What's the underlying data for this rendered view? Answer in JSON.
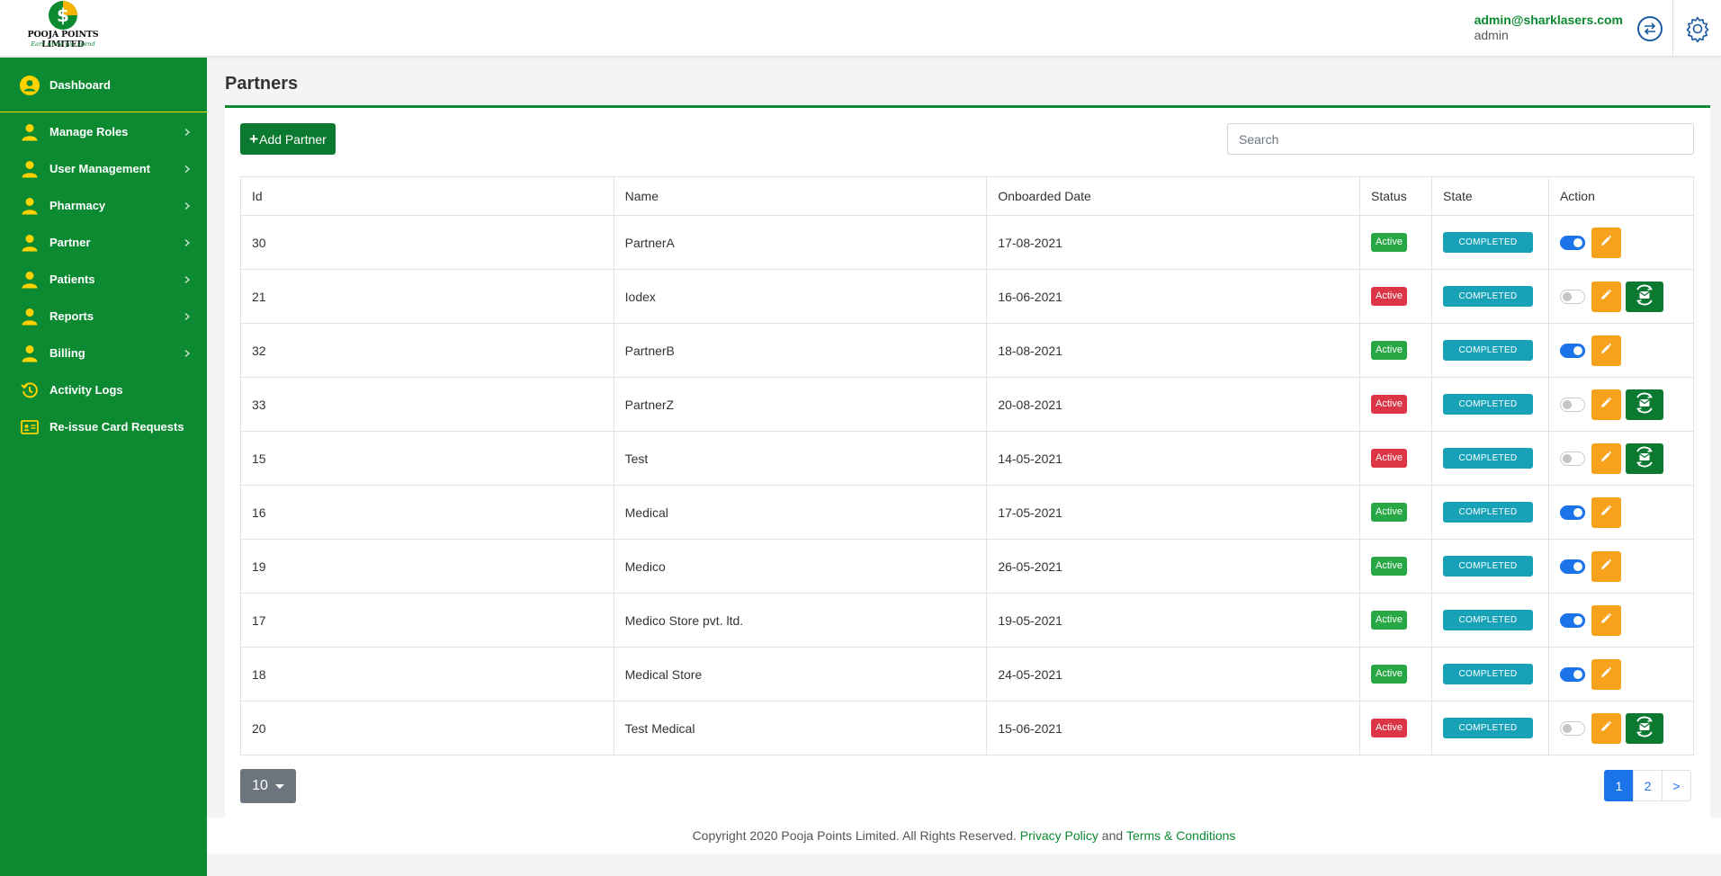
{
  "header": {
    "brand_title": "POOJA POINTS LIMITED",
    "brand_tagline": "Earn while you spend",
    "user_email": "admin@sharklasers.com",
    "user_role": "admin",
    "icons": {
      "swap": "swap-icon",
      "settings": "gear-icon"
    }
  },
  "sidebar": {
    "items": [
      {
        "label": "Dashboard",
        "icon": "user-circle-icon",
        "chevron": false
      },
      {
        "label": "Manage Roles",
        "icon": "user-icon",
        "chevron": true
      },
      {
        "label": "User Management",
        "icon": "user-icon",
        "chevron": true
      },
      {
        "label": "Pharmacy",
        "icon": "user-icon",
        "chevron": true
      },
      {
        "label": "Partner",
        "icon": "user-icon",
        "chevron": true
      },
      {
        "label": "Patients",
        "icon": "user-icon",
        "chevron": true
      },
      {
        "label": "Reports",
        "icon": "user-icon",
        "chevron": true
      },
      {
        "label": "Billing",
        "icon": "user-icon",
        "chevron": true
      },
      {
        "label": "Activity Logs",
        "icon": "history-icon",
        "chevron": false
      },
      {
        "label": "Re-issue Card Requests",
        "icon": "id-card-icon",
        "chevron": false
      }
    ]
  },
  "main": {
    "title": "Partners",
    "add_button_label": "Add Partner",
    "search_placeholder": "Search",
    "columns": [
      "Id",
      "Name",
      "Onboarded Date",
      "Status",
      "State",
      "Action"
    ],
    "rows": [
      {
        "id": "30",
        "name": "PartnerA",
        "date": "17-08-2021",
        "status": "Active",
        "status_ok": true,
        "state": "COMPLETED",
        "enabled": true,
        "resend": false
      },
      {
        "id": "21",
        "name": "Iodex",
        "date": "16-06-2021",
        "status": "Active",
        "status_ok": false,
        "state": "COMPLETED",
        "enabled": false,
        "resend": true
      },
      {
        "id": "32",
        "name": "PartnerB",
        "date": "18-08-2021",
        "status": "Active",
        "status_ok": true,
        "state": "COMPLETED",
        "enabled": true,
        "resend": false
      },
      {
        "id": "33",
        "name": "PartnerZ",
        "date": "20-08-2021",
        "status": "Active",
        "status_ok": false,
        "state": "COMPLETED",
        "enabled": false,
        "resend": true
      },
      {
        "id": "15",
        "name": "Test",
        "date": "14-05-2021",
        "status": "Active",
        "status_ok": false,
        "state": "COMPLETED",
        "enabled": false,
        "resend": true
      },
      {
        "id": "16",
        "name": "Medical",
        "date": "17-05-2021",
        "status": "Active",
        "status_ok": true,
        "state": "COMPLETED",
        "enabled": true,
        "resend": false
      },
      {
        "id": "19",
        "name": "Medico",
        "date": "26-05-2021",
        "status": "Active",
        "status_ok": true,
        "state": "COMPLETED",
        "enabled": true,
        "resend": false
      },
      {
        "id": "17",
        "name": "Medico Store pvt. ltd.",
        "date": "19-05-2021",
        "status": "Active",
        "status_ok": true,
        "state": "COMPLETED",
        "enabled": true,
        "resend": false
      },
      {
        "id": "18",
        "name": "Medical Store",
        "date": "24-05-2021",
        "status": "Active",
        "status_ok": true,
        "state": "COMPLETED",
        "enabled": true,
        "resend": false
      },
      {
        "id": "20",
        "name": "Test Medical",
        "date": "15-06-2021",
        "status": "Active",
        "status_ok": false,
        "state": "COMPLETED",
        "enabled": false,
        "resend": true
      }
    ],
    "page_size": "10",
    "pagination": {
      "pages": [
        "1",
        "2"
      ],
      "current": "1",
      "next_label": ">"
    }
  },
  "footer": {
    "copyright": "Copyright 2020 Pooja Points Limited. All Rights Reserved.",
    "privacy_label": "Privacy Policy",
    "and_text": "and",
    "terms_label": "Terms & Conditions"
  },
  "colors": {
    "brand_green": "#0b8a32",
    "accent_yellow": "#ffd200",
    "status_active": "#28a745",
    "status_inactive": "#dc3545",
    "state_completed": "#17a2b8",
    "edit_orange": "#f7a21b",
    "primary_blue": "#1a73e8"
  }
}
